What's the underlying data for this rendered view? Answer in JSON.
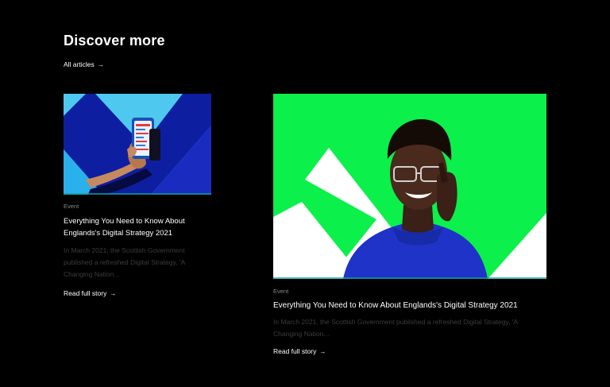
{
  "section": {
    "title": "Discover more",
    "all_link_label": "All articles",
    "arrow_glyph": "→"
  },
  "cards": [
    {
      "tag": "Event",
      "title": "Everything You Need to Know About Englands's Digital Strategy 2021",
      "excerpt": "In March 2021, the Scottish Government published a refreshed Digital Strategy, 'A Changing Nation...",
      "cta": "Read full story",
      "image_icon": "phone-in-hand-illustration",
      "image_colors": {
        "background": "#4fc8f0",
        "stripe": "#0d1fa0",
        "phone": "#2f8be0"
      }
    },
    {
      "tag": "Event",
      "title": "Everything You Need to Know About Englands's Digital Strategy 2021",
      "excerpt": "In March 2021, the Scottish Government published a refreshed Digital Strategy, 'A Changing Nation...",
      "cta": "Read full story",
      "image_icon": "person-with-glasses-photo",
      "image_colors": {
        "background": "#0bf04a",
        "shape": "#ffffff",
        "sweater": "#1f33c8",
        "skin": "#3a2016"
      }
    }
  ],
  "theme": {
    "page_background": "#000000",
    "text_primary": "#ffffff",
    "text_muted": "#3c3c3c",
    "tag_color": "#8a8a8a"
  }
}
